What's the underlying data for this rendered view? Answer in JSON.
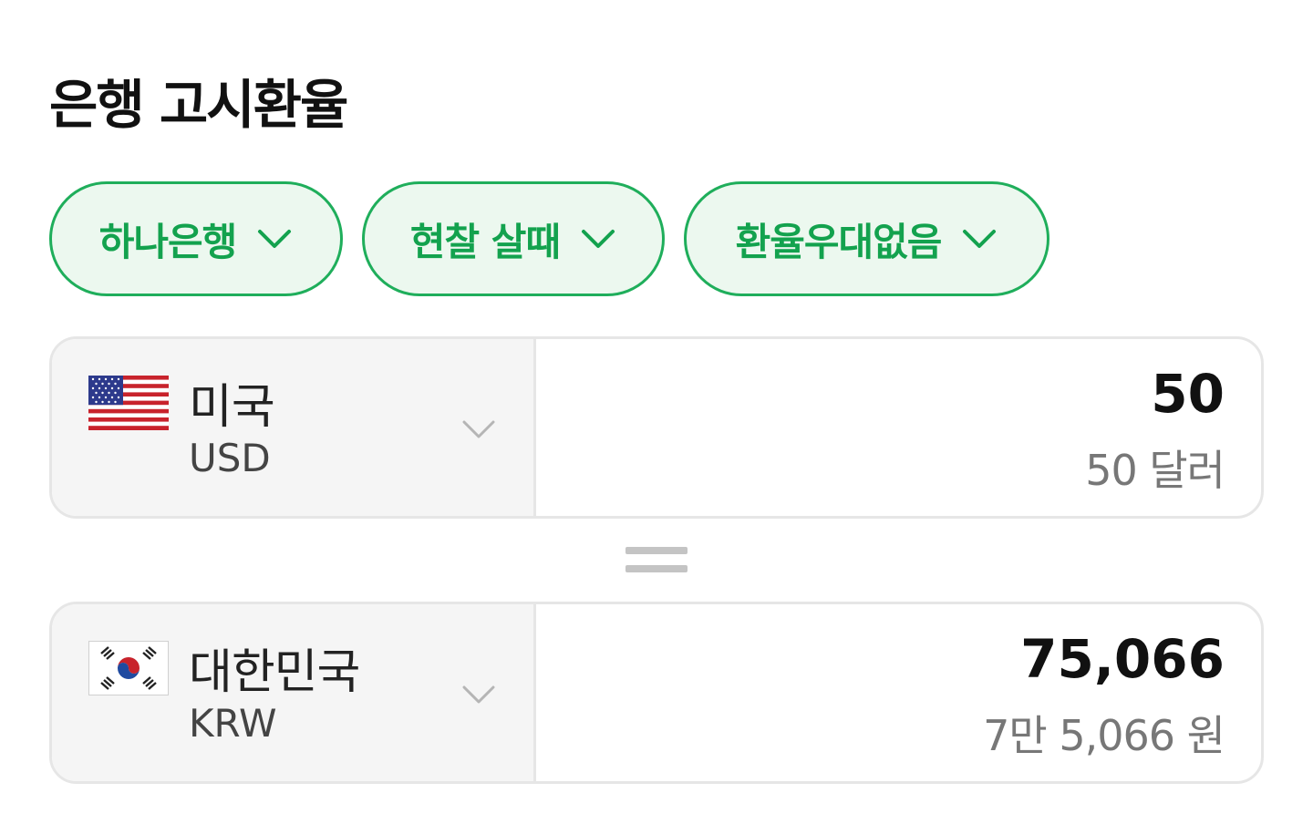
{
  "title": "은행 고시환율",
  "filters": [
    {
      "label": "하나은행"
    },
    {
      "label": "현찰 살때"
    },
    {
      "label": "환율우대없음"
    }
  ],
  "from": {
    "country": "미국",
    "code": "USD",
    "amount": "50",
    "amount_words": "50 달러",
    "flag_icon": "us-flag-icon"
  },
  "to": {
    "country": "대한민국",
    "code": "KRW",
    "amount": "75,066",
    "amount_words": "7만 5,066 원",
    "flag_icon": "kr-flag-icon"
  },
  "colors": {
    "accent": "#1fae5b",
    "chip_bg": "#ecf8ef",
    "selector_bg": "#f5f5f5"
  }
}
